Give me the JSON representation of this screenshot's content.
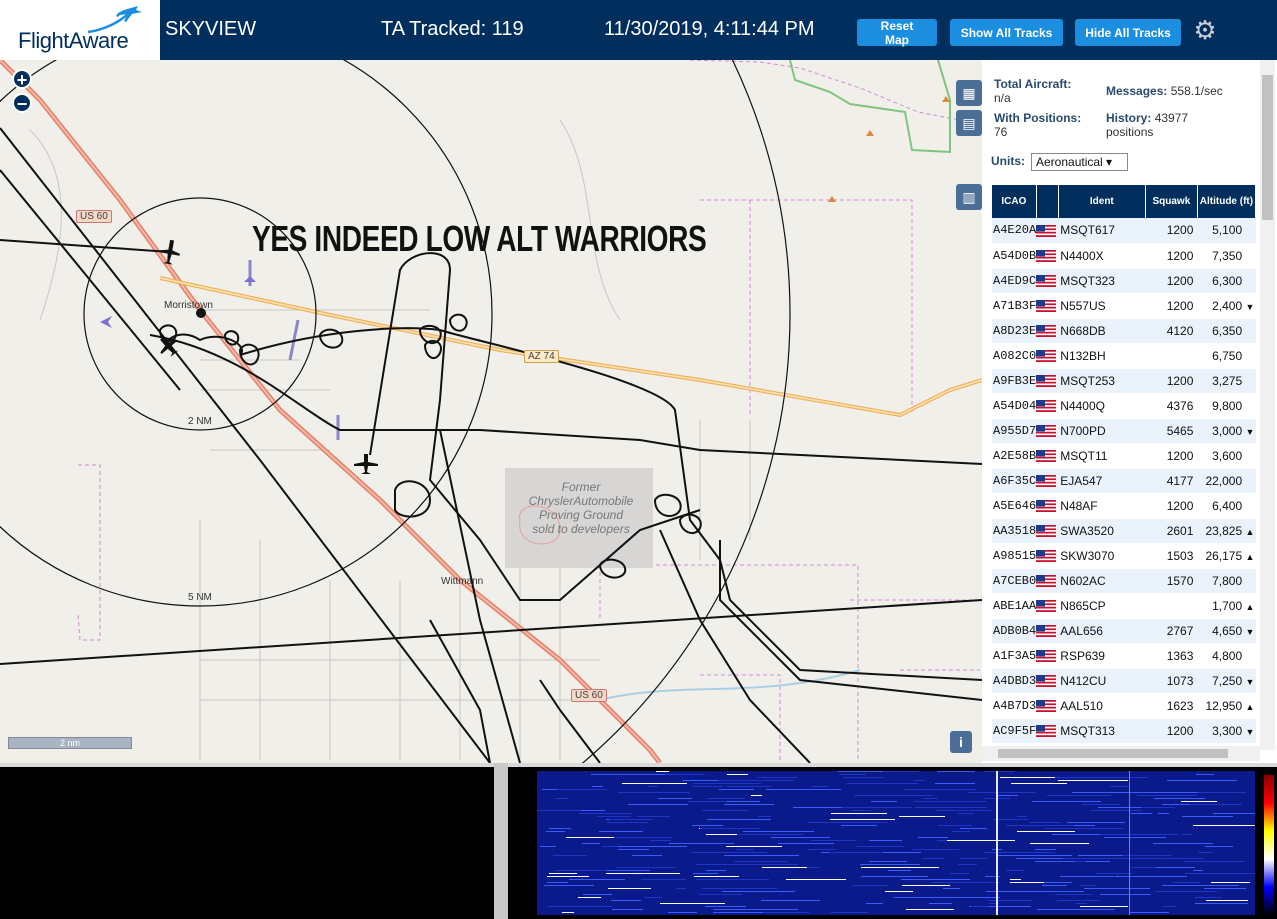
{
  "header": {
    "logo_text": "FlightAware",
    "app_title": "SKYVIEW",
    "ta_tracked": "TA Tracked: 119",
    "clock": "11/30/2019, 4:11:44 PM",
    "buttons": {
      "reset_map": "Reset Map",
      "show_all_tracks": "Show All Tracks",
      "hide_all_tracks": "Hide All Tracks"
    },
    "settings_icon": "gear-icon"
  },
  "map": {
    "overlay_text": "YES INDEED LOW ALT WARRIORS",
    "zoom_in": "+",
    "zoom_out": "−",
    "labels": {
      "town1": "Morristown",
      "town2": "Wittmann",
      "ring1": "2 NM",
      "ring2": "5 NM",
      "proving_ground": "Former ChryslerAutomobile Proving Ground sold to developers"
    },
    "shields": {
      "us60_a": "US 60",
      "us60_b": "US 60",
      "az74": "AZ 74"
    },
    "scale": "2 nm",
    "info": "i"
  },
  "sidebar": {
    "stats": {
      "total_aircraft_label": "Total Aircraft:",
      "total_aircraft_value": "n/a",
      "with_positions_label": "With Positions:",
      "with_positions_value": "76",
      "messages_label": "Messages:",
      "messages_value": "558.1/sec",
      "history_label": "History:",
      "history_value": "43977",
      "history_unit": "positions"
    },
    "units_label": "Units:",
    "units_value": "Aeronautical",
    "table": {
      "headers": {
        "icao": "ICAO",
        "flag": "",
        "ident": "Ident",
        "squawk": "Squawk",
        "altitude": "Altitude (ft)"
      },
      "rows": [
        {
          "icao": "A4E20A",
          "ident": "MSQT617",
          "squawk": "1200",
          "alt": "5,100",
          "trend": ""
        },
        {
          "icao": "A54D0B",
          "ident": "N4400X",
          "squawk": "1200",
          "alt": "7,350",
          "trend": ""
        },
        {
          "icao": "A4ED9C",
          "ident": "MSQT323",
          "squawk": "1200",
          "alt": "6,300",
          "trend": ""
        },
        {
          "icao": "A71B3F",
          "ident": "N557US",
          "squawk": "1200",
          "alt": "2,400",
          "trend": "▼"
        },
        {
          "icao": "A8D23E",
          "ident": "N668DB",
          "squawk": "4120",
          "alt": "6,350",
          "trend": ""
        },
        {
          "icao": "A082C0",
          "ident": "N132BH",
          "squawk": "",
          "alt": "6,750",
          "trend": ""
        },
        {
          "icao": "A9FB3E",
          "ident": "MSQT253",
          "squawk": "1200",
          "alt": "3,275",
          "trend": ""
        },
        {
          "icao": "A54D04",
          "ident": "N4400Q",
          "squawk": "4376",
          "alt": "9,800",
          "trend": ""
        },
        {
          "icao": "A955D7",
          "ident": "N700PD",
          "squawk": "5465",
          "alt": "3,000",
          "trend": "▼"
        },
        {
          "icao": "A2E58B",
          "ident": "MSQT11",
          "squawk": "1200",
          "alt": "3,600",
          "trend": ""
        },
        {
          "icao": "A6F35C",
          "ident": "EJA547",
          "squawk": "4177",
          "alt": "22,000",
          "trend": ""
        },
        {
          "icao": "A5E646",
          "ident": "N48AF",
          "squawk": "1200",
          "alt": "6,400",
          "trend": ""
        },
        {
          "icao": "AA3518",
          "ident": "SWA3520",
          "squawk": "2601",
          "alt": "23,825",
          "trend": "▲"
        },
        {
          "icao": "A98515",
          "ident": "SKW3070",
          "squawk": "1503",
          "alt": "26,175",
          "trend": "▲"
        },
        {
          "icao": "A7CEB0",
          "ident": "N602AC",
          "squawk": "1570",
          "alt": "7,800",
          "trend": ""
        },
        {
          "icao": "ABE1AA",
          "ident": "N865CP",
          "squawk": "",
          "alt": "1,700",
          "trend": "▲"
        },
        {
          "icao": "ADB0B4",
          "ident": "AAL656",
          "squawk": "2767",
          "alt": "4,650",
          "trend": "▼"
        },
        {
          "icao": "A1F3A5",
          "ident": "RSP639",
          "squawk": "1363",
          "alt": "4,800",
          "trend": ""
        },
        {
          "icao": "A4DBD3",
          "ident": "N412CU",
          "squawk": "1073",
          "alt": "7,250",
          "trend": "▼"
        },
        {
          "icao": "A4B7D3",
          "ident": "AAL510",
          "squawk": "1623",
          "alt": "12,950",
          "trend": "▲"
        },
        {
          "icao": "AC9F5F",
          "ident": "MSQT313",
          "squawk": "1200",
          "alt": "3,300",
          "trend": "▼"
        }
      ]
    }
  },
  "colors": {
    "header_bg": "#002f5d",
    "button_bg": "#1c8ee0",
    "table_header_bg": "#002f5d",
    "row_alt_bg": "#eaf3fb"
  }
}
